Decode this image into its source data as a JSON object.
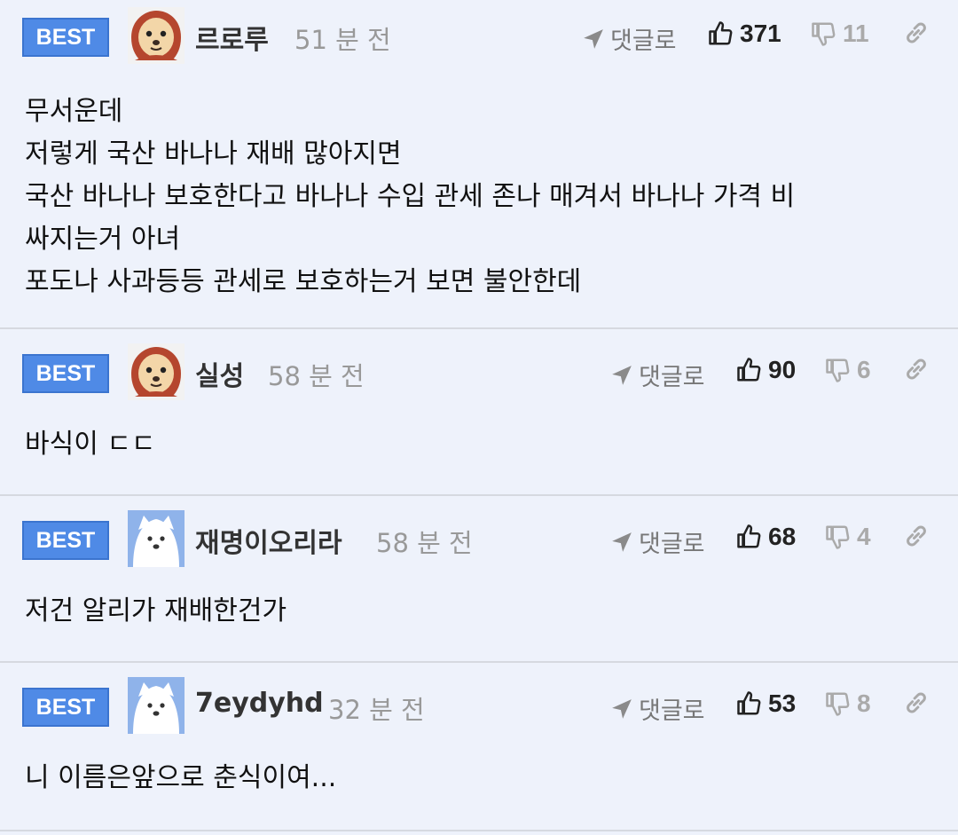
{
  "comments": [
    {
      "badge": "BEST",
      "nickname": "르로루",
      "time": "51 분 전",
      "reply_label": "댓글로",
      "likes": "371",
      "dislikes": "11",
      "avatar": "puppy-avatar",
      "lines": [
        "무서운데",
        "저렇게 국산 바나나 재배 많아지면",
        "국산 바나나 보호한다고 바나나 수입 관세 존나 매겨서 바나나 가격 비",
        "싸지는거 아녀",
        "포도나 사과등등 관세로 보호하는거 보면 불안한데"
      ]
    },
    {
      "badge": "BEST",
      "nickname": "실성",
      "time": "58 분 전",
      "reply_label": "댓글로",
      "likes": "90",
      "dislikes": "6",
      "avatar": "puppy-avatar",
      "lines": [
        "바식이 ㄷㄷ"
      ]
    },
    {
      "badge": "BEST",
      "nickname": "재명이오리라",
      "time": "58 분 전",
      "reply_label": "댓글로",
      "likes": "68",
      "dislikes": "4",
      "avatar": "white-dog-avatar",
      "lines": [
        "저건 알리가 재배한건가"
      ]
    },
    {
      "badge": "BEST",
      "nickname": "7eydyhd",
      "time": "32 분 전",
      "reply_label": "댓글로",
      "likes": "53",
      "dislikes": "8",
      "avatar": "white-dog-avatar",
      "lines": [
        "니 이름은앞으로 춘식이여..."
      ]
    }
  ],
  "colors": {
    "badge": "#4f8ae6",
    "background": "#eef2fb",
    "divider": "#d6d9e0"
  }
}
